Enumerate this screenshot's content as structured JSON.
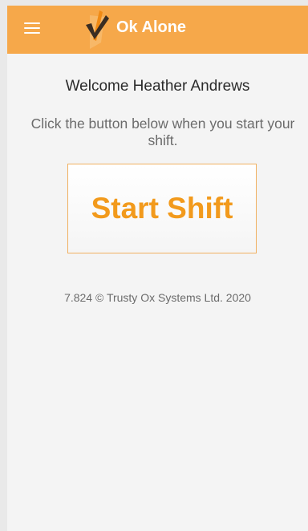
{
  "app": {
    "title": "Ok Alone",
    "brand_color": "#f6a84a",
    "accent_color": "#f29a1c"
  },
  "header": {
    "menu_icon": "hamburger-menu-icon",
    "logo_icon": "ok-alone-checkmark-logo"
  },
  "main": {
    "welcome_text": "Welcome Heather Andrews",
    "instruction_text": "Click the button below when you start your shift.",
    "start_button_label": "Start Shift"
  },
  "footer": {
    "version_text": "7.824 © Trusty Ox Systems Ltd. 2020"
  }
}
